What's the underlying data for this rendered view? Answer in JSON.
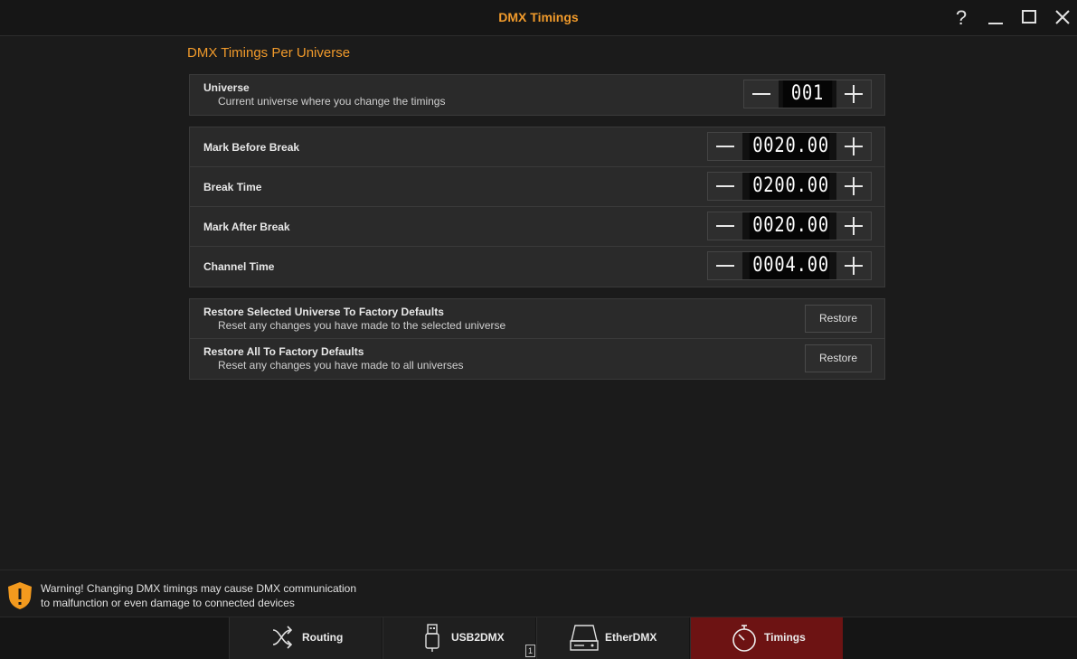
{
  "window": {
    "title": "DMX Timings",
    "controls": [
      "help-icon",
      "minimize-icon",
      "maximize-icon",
      "close-icon"
    ]
  },
  "section": {
    "title": "DMX Timings Per Universe"
  },
  "universe": {
    "label": "Universe",
    "description": "Current universe where you change the timings",
    "value": "001",
    "minus_icon": "minus-icon",
    "plus_icon": "plus-icon"
  },
  "timings": [
    {
      "label": "Mark Before Break",
      "value": "0020.00"
    },
    {
      "label": "Break Time",
      "value": "0200.00"
    },
    {
      "label": "Mark After Break",
      "value": "0020.00"
    },
    {
      "label": "Channel Time",
      "value": "0004.00"
    }
  ],
  "restore": [
    {
      "title": "Restore Selected Universe To Factory Defaults",
      "description": "Reset any changes you have made to the selected universe",
      "button": "Restore"
    },
    {
      "title": "Restore All To Factory Defaults",
      "description": "Reset any changes you have made to all universes",
      "button": "Restore"
    }
  ],
  "warning": {
    "icon": "warning-shield-icon",
    "line1": "Warning! Changing DMX timings may cause DMX communication",
    "line2": "to malfunction or even damage to connected devices"
  },
  "tabs": [
    {
      "label": "Routing",
      "icon": "routing-icon",
      "active": false
    },
    {
      "label": "USB2DMX",
      "icon": "usb-icon",
      "badge": "1",
      "active": false
    },
    {
      "label": "EtherDMX",
      "icon": "ethernet-device-icon",
      "active": false
    },
    {
      "label": "Timings",
      "icon": "stopwatch-icon",
      "active": true
    }
  ],
  "colors": {
    "accent": "#f09a2b",
    "active_tab": "#6d1313",
    "background": "#1b1b1b"
  }
}
